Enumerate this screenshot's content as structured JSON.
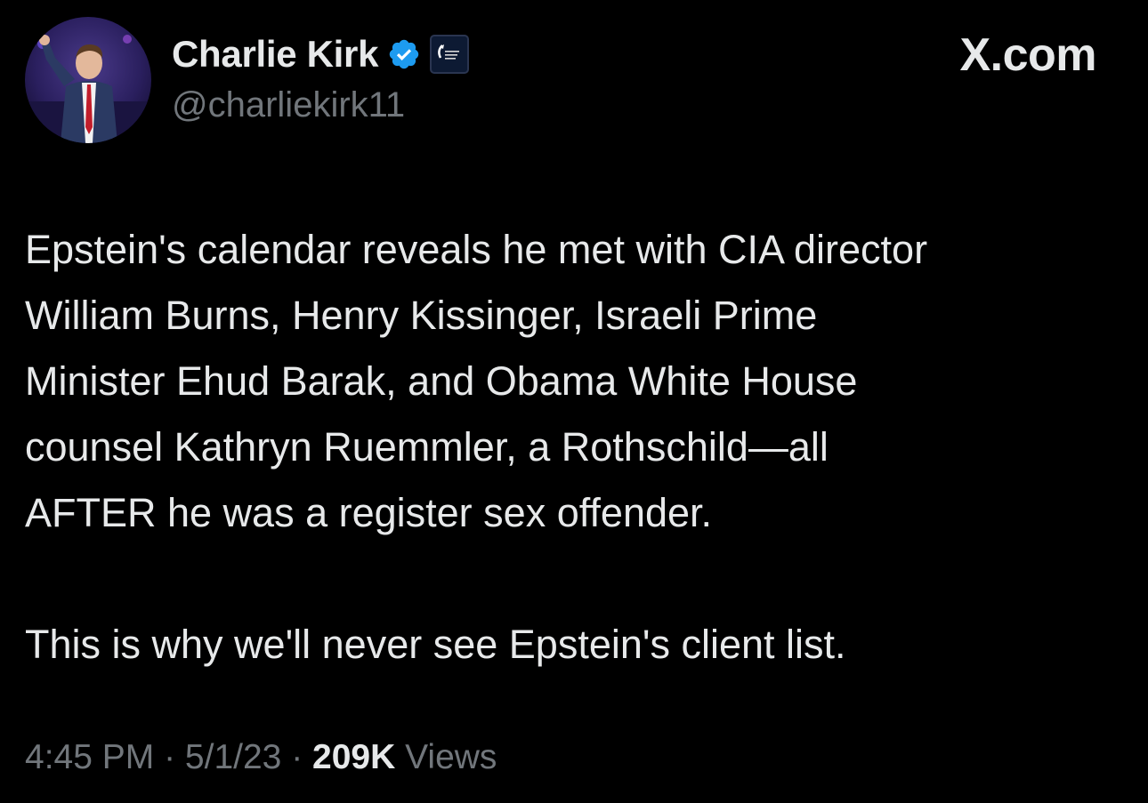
{
  "author": {
    "display_name": "Charlie Kirk",
    "handle": "@charliekirk11",
    "verified_icon": "verified-badge-icon",
    "affiliate_icon": "organization-affiliate-badge"
  },
  "site": {
    "label": "X.com"
  },
  "tweet": {
    "paragraph_1": "Epstein's calendar reveals he met with CIA director\nWilliam Burns, Henry Kissinger, Israeli Prime\nMinister Ehud Barak, and Obama White House\ncounsel Kathryn Ruemmler, a Rothschild—all\nAFTER he was a register sex offender.",
    "paragraph_2": "This is why we'll never see Epstein's client list."
  },
  "meta": {
    "time": "4:45 PM",
    "separator": " · ",
    "date": "5/1/23",
    "views_count": "209K",
    "views_label": " Views"
  },
  "colors": {
    "background": "#000000",
    "primary_text": "#e7e9ea",
    "secondary_text": "#71767b",
    "verified_blue": "#1d9bf0"
  }
}
